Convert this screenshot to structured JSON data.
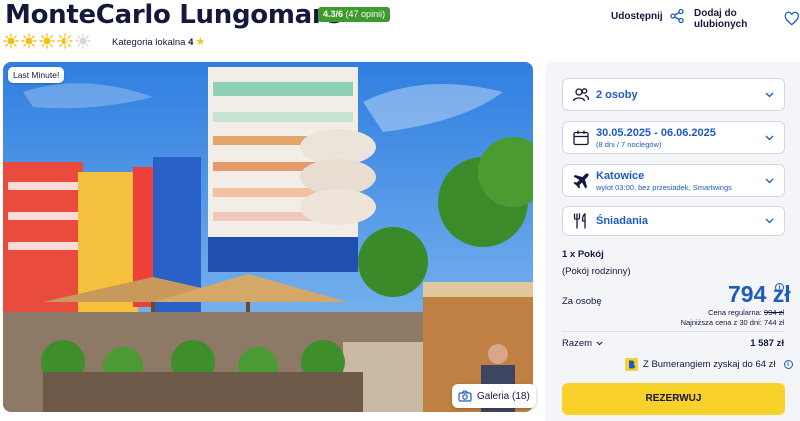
{
  "hotel": {
    "name": "MonteCarlo Lungomare",
    "rating_score": "4.3/6",
    "rating_count": "(47 opinii)",
    "category_label": "Kategoria lokalna",
    "category_value": "4",
    "suns": {
      "full": 3,
      "half": 1,
      "empty": 1,
      "total": 5
    }
  },
  "actions": {
    "share_label": "Udostępnij",
    "favorite_label": "Dodaj do ulubionych"
  },
  "photo": {
    "badge": "Last Minute!",
    "gallery_label": "Galeria (18)"
  },
  "booking": {
    "persons": {
      "value": "2 osoby",
      "icon": "person-icon"
    },
    "dates": {
      "value": "30.05.2025 - 06.06.2025",
      "sub": "(8 dni / 7 noclegów)",
      "icon": "calendar-icon"
    },
    "departure": {
      "value": "Katowice",
      "sub": "wylot 03:00, bez przesiadek, Smartwings",
      "icon": "plane-icon"
    },
    "board": {
      "value": "Śniadania",
      "icon": "cutlery-icon"
    },
    "room_count": "1 x Pokój",
    "room_type": "(Pokój rodzinny)",
    "per_person_label": "Za osobę",
    "price": "794 zł",
    "regular_label": "Cena regularna:",
    "regular_price": "994 zł",
    "lowest_label": "Najniższa cena z 30 dni: 744 zł",
    "total_label": "Razem",
    "total_value": "1 587 zł",
    "bumerang_text": "Z Bumerangiem zyskaj do 64 zł",
    "reserve_label": "REZERWUJ"
  },
  "colors": {
    "accent": "#1e5bbf",
    "rating_badge": "#3f9a2d",
    "reserve_button": "#f8d12a",
    "sun": "#f4c11a",
    "star": "#f3c316"
  }
}
